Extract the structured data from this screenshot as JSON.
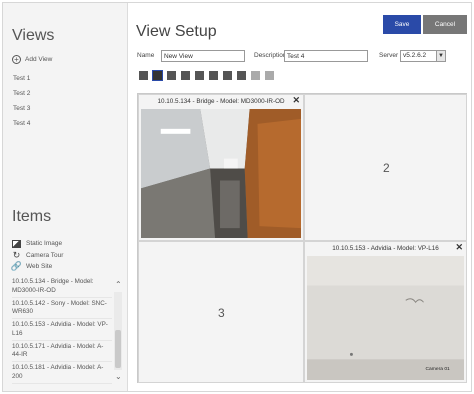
{
  "sidebar": {
    "views_title": "Views",
    "add_view_label": "Add View",
    "views": [
      "Test 1",
      "Test 2",
      "Test 3",
      "Test 4"
    ],
    "items_title": "Items",
    "item_types": [
      {
        "label": "Static Image",
        "icon": "image-icon"
      },
      {
        "label": "Camera Tour",
        "icon": "camera-tour-icon"
      },
      {
        "label": "Web Site",
        "icon": "link-icon"
      }
    ],
    "cameras": [
      "10.10.5.134 - Bridge - Model: MD3000-IR-OD",
      "10.10.5.142 - Sony - Model: SNC-WR630",
      "10.10.5.153 - Advidia - Model: VP-L16",
      "10.10.5.171 - Advidia - Model: A-44-IR",
      "10.10.5.181 - Advidia - Model: A-200"
    ]
  },
  "header": {
    "title": "View Setup",
    "save_label": "Save",
    "cancel_label": "Cancel"
  },
  "form": {
    "name_label": "Name",
    "name_value": "New View",
    "description_label": "Description",
    "description_value": "Test 4",
    "server_label": "Server",
    "server_value": "v5.2.6.2"
  },
  "grid": {
    "cell1_title": "10.10.5.134 - Bridge - Model: MD3000-IR-OD",
    "cell2_number": "2",
    "cell3_number": "3",
    "cell4_title": "10.10.5.153 - Advidia - Model: VP-L16",
    "cell4_overlay": "Camera 01"
  },
  "colors": {
    "save_button": "#2a4aa8",
    "cancel_button": "#777777"
  }
}
